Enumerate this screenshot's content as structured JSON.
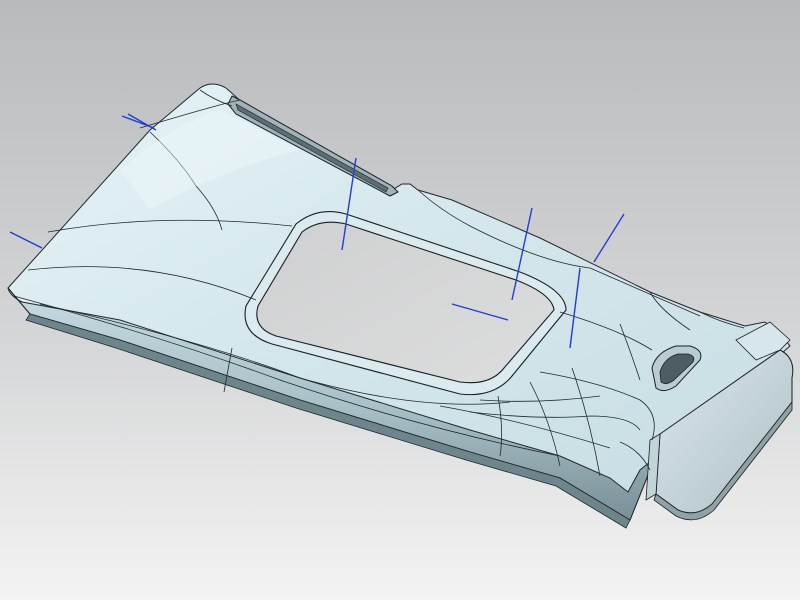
{
  "viewport": {
    "background_top": "#b7b9bb",
    "background_bottom": "#f4f4f4",
    "part_face": "#cfe3e9",
    "part_highlight": "#e9f5f8",
    "part_shadow": "#7f979e",
    "edge_color": "#1a1f22",
    "curve_color": "#1f3fd6"
  }
}
